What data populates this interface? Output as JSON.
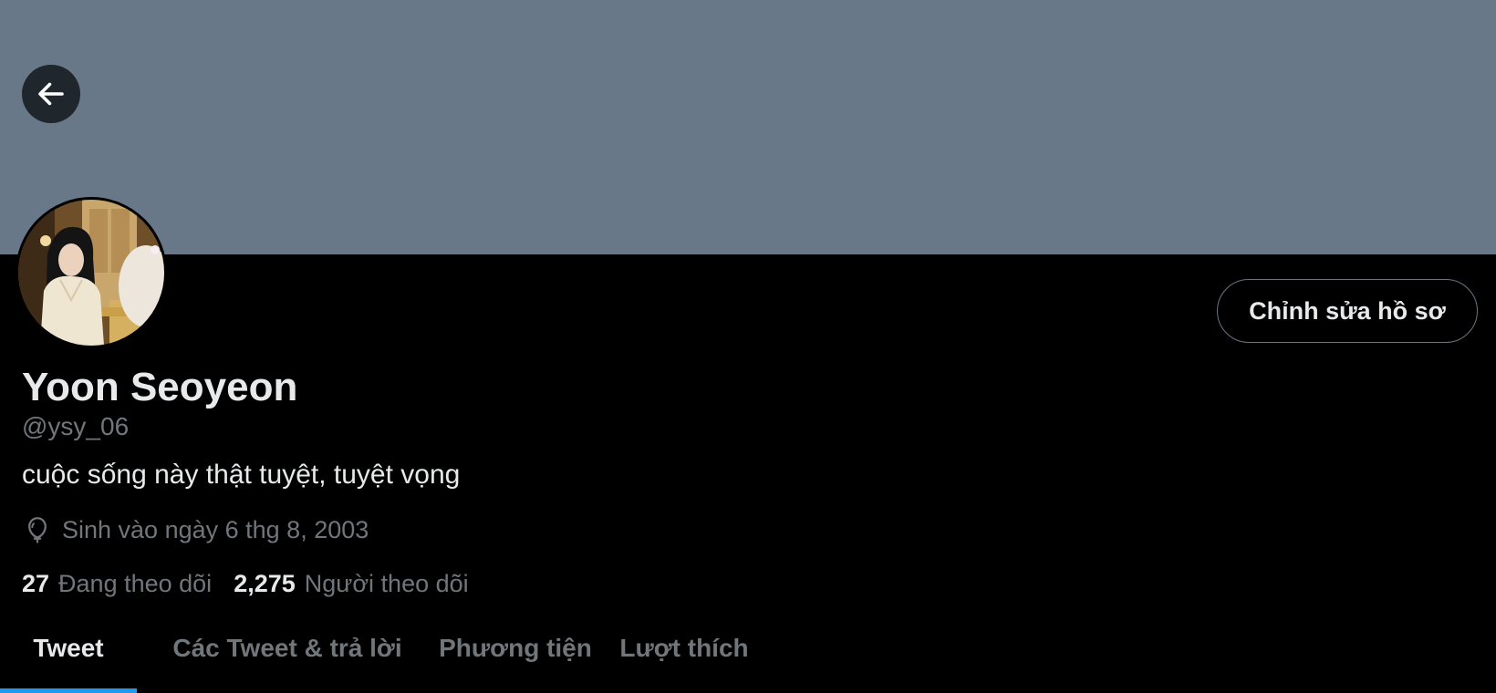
{
  "colors": {
    "banner": "#697888",
    "background": "#000000",
    "primary_text": "#e7e9ea",
    "secondary_text": "#71767b",
    "accent": "#1d9bf0"
  },
  "header": {
    "back_icon": "arrow-left-icon"
  },
  "profile": {
    "display_name": "Yoon Seoyeon",
    "handle": "@ysy_06",
    "bio": "cuộc sống này thật tuyệt, tuyệt vọng",
    "birthday_icon": "balloon-icon",
    "birthday_text": "Sinh vào ngày 6 thg 8, 2003",
    "edit_profile_label": "Chỉnh sửa hồ sơ"
  },
  "stats": {
    "following_count": "27",
    "following_label": "Đang theo dõi",
    "followers_count": "2,275",
    "followers_label": "Người theo dõi"
  },
  "tabs": [
    {
      "label": "Tweet",
      "active": true
    },
    {
      "label": "Các Tweet & trả lời",
      "active": false
    },
    {
      "label": "Phương tiện",
      "active": false
    },
    {
      "label": "Lượt thích",
      "active": false
    }
  ]
}
